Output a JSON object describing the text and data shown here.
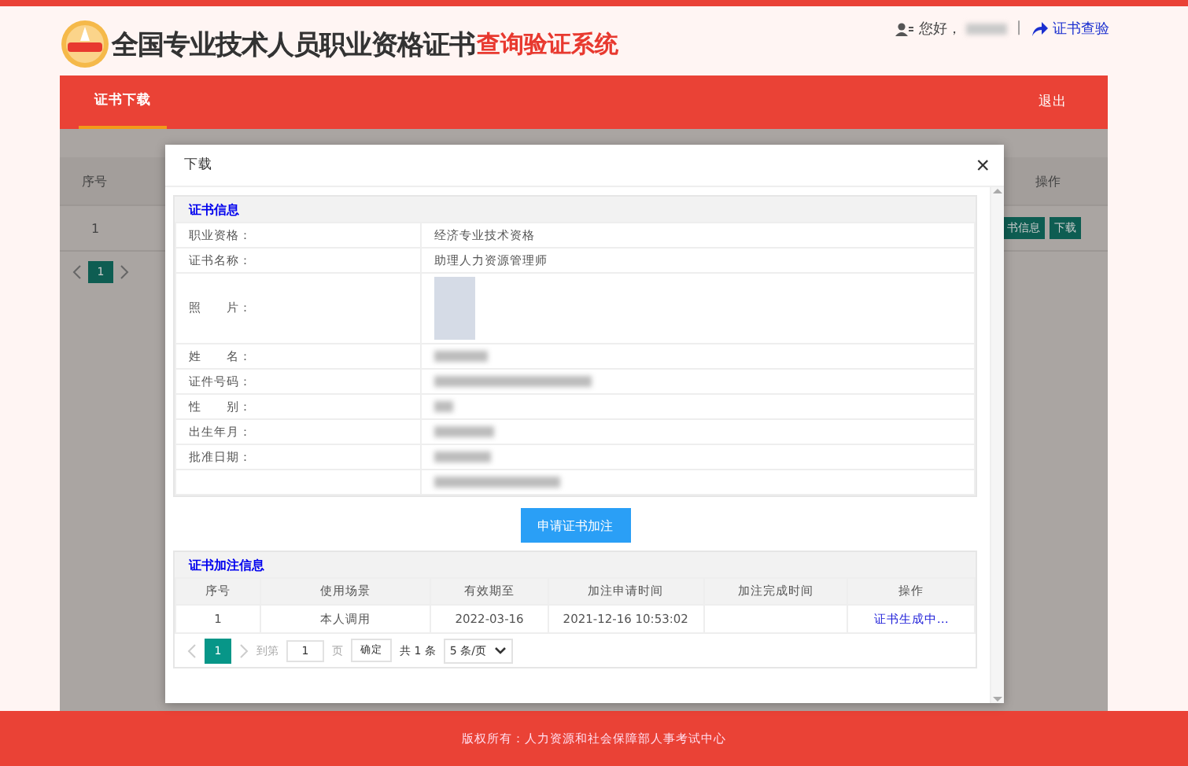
{
  "top_bar": {
    "title": "全国专业技术人员职业资格证书",
    "title_highlight": "查询验证系统",
    "greeting": "您好，",
    "separator": "|",
    "verify_link": "证书查验"
  },
  "nav": {
    "tabs": [
      {
        "label": "证书下载",
        "selected": true
      }
    ],
    "logout": "退出"
  },
  "background_table": {
    "columns": [
      "序号",
      "操作"
    ],
    "rows": [
      {
        "index": "1",
        "actions": [
          "书信息",
          "下载"
        ]
      }
    ],
    "pages": [
      {
        "label": "1",
        "selected": true
      }
    ]
  },
  "modal": {
    "title": "下载",
    "close": "×",
    "cert_info": {
      "title": "证书信息",
      "rows": [
        {
          "kind": "text",
          "label": "职业资格：",
          "value": "经济专业技术资格"
        },
        {
          "kind": "text",
          "label": "证书名称：",
          "value": "助理人力资源管理师"
        },
        {
          "kind": "photo",
          "label": "照　　片："
        },
        {
          "kind": "redacted",
          "label": "姓　　名："
        },
        {
          "kind": "redacted",
          "label": "证件号码："
        },
        {
          "kind": "redacted",
          "label": "性　　别："
        },
        {
          "kind": "redacted",
          "label": "出生年月："
        },
        {
          "kind": "redacted",
          "label": "批准日期："
        },
        {
          "kind": "redacted"
        }
      ]
    },
    "apply_button": "申请证书加注",
    "annotation_info": {
      "title": "证书加注信息",
      "columns": [
        "序号",
        "使用场景",
        "有效期至",
        "加注申请时间",
        "加注完成时间",
        "操作"
      ],
      "rows": [
        {
          "index": "1",
          "scene": "本人调用",
          "valid_until": "2022-03-16",
          "applied_at": "2021-12-16 10:53:02",
          "action": "证书生成中…"
        }
      ],
      "pagination": {
        "pages": [
          {
            "label": "1",
            "selected": true
          }
        ],
        "goto_label": "到第",
        "page_input": "1",
        "page_unit": "页",
        "confirm": "确定",
        "total": "共 1 条",
        "page_size": "5 条/页"
      }
    }
  },
  "footer": "版权所有：人力资源和社会保障部人事考试中心"
}
